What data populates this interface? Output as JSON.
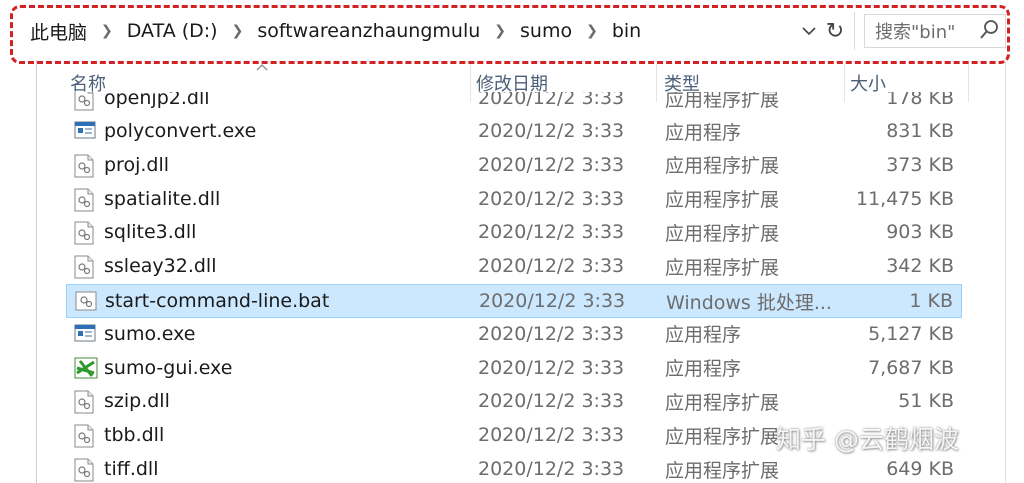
{
  "address": {
    "breadcrumbs": [
      "此电脑",
      "DATA (D:)",
      "softwareanzhaungmulu",
      "sumo",
      "bin"
    ],
    "search_placeholder": "搜索\"bin\""
  },
  "columns": {
    "name": "名称",
    "date": "修改日期",
    "type": "类型",
    "size": "大小"
  },
  "partial_row": {
    "name": "openjp2.dll",
    "date": "2020/12/2 3:33",
    "type": "应用程序扩展",
    "size": "178 KB"
  },
  "files": [
    {
      "name": "polyconvert.exe",
      "date": "2020/12/2 3:33",
      "type": "应用程序",
      "size": "831 KB",
      "icon": "exe-icon",
      "selected": false
    },
    {
      "name": "proj.dll",
      "date": "2020/12/2 3:33",
      "type": "应用程序扩展",
      "size": "373 KB",
      "icon": "dll-icon",
      "selected": false
    },
    {
      "name": "spatialite.dll",
      "date": "2020/12/2 3:33",
      "type": "应用程序扩展",
      "size": "11,475 KB",
      "icon": "dll-icon",
      "selected": false
    },
    {
      "name": "sqlite3.dll",
      "date": "2020/12/2 3:33",
      "type": "应用程序扩展",
      "size": "903 KB",
      "icon": "dll-icon",
      "selected": false
    },
    {
      "name": "ssleay32.dll",
      "date": "2020/12/2 3:33",
      "type": "应用程序扩展",
      "size": "342 KB",
      "icon": "dll-icon",
      "selected": false
    },
    {
      "name": "start-command-line.bat",
      "date": "2020/12/2 3:33",
      "type": "Windows 批处理...",
      "size": "1 KB",
      "icon": "bat-icon",
      "selected": true
    },
    {
      "name": "sumo.exe",
      "date": "2020/12/2 3:33",
      "type": "应用程序",
      "size": "5,127 KB",
      "icon": "exe-icon",
      "selected": false
    },
    {
      "name": "sumo-gui.exe",
      "date": "2020/12/2 3:33",
      "type": "应用程序",
      "size": "7,687 KB",
      "icon": "sumo-gui-icon",
      "selected": false
    },
    {
      "name": "szip.dll",
      "date": "2020/12/2 3:33",
      "type": "应用程序扩展",
      "size": "51 KB",
      "icon": "dll-icon",
      "selected": false
    },
    {
      "name": "tbb.dll",
      "date": "2020/12/2 3:33",
      "type": "应用程序扩展",
      "size": "",
      "icon": "dll-icon",
      "selected": false
    },
    {
      "name": "tiff.dll",
      "date": "2020/12/2 3:33",
      "type": "应用程序扩展",
      "size": "649 KB",
      "icon": "dll-icon",
      "selected": false
    }
  ],
  "watermark": "知乎 @云鹤烟波",
  "colors": {
    "selection_bg": "#cce8ff",
    "selection_border": "#99d1ff",
    "highlight": "#d22222",
    "header_text": "#4c607a"
  }
}
